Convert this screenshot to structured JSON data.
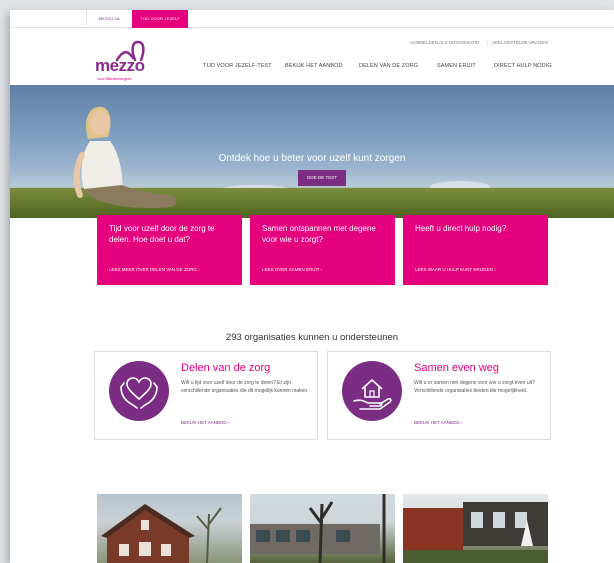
{
  "colors": {
    "brand_pink": "#e5007e",
    "brand_purple": "#7a2d82",
    "logo_purple": "#8a2c8b"
  },
  "top_tabs": [
    {
      "label": "Mezzo.nl",
      "active": false
    },
    {
      "label": "Tijd voor jezelf",
      "active": true
    }
  ],
  "logo": {
    "word": "mezzo",
    "sub": "voor Mantelzorgers"
  },
  "utility_nav": [
    {
      "label": "Aanmelden als organisatie"
    },
    {
      "label": "|"
    },
    {
      "label": "Veelgestelde vragen"
    }
  ],
  "main_nav": [
    {
      "label": "Tijd voor jezelf-test"
    },
    {
      "label": "Bekijk het aanbod"
    },
    {
      "label": "Delen van de zorg"
    },
    {
      "label": "Samen eruit"
    },
    {
      "label": "Direct hulp nodig"
    }
  ],
  "hero": {
    "title": "Ontdek hoe u beter voor uzelf kunt zorgen",
    "button": "Doe de test"
  },
  "promos": [
    {
      "title": "Tijd voor uzelf door de zorg te delen. Hoe doet u dat?",
      "link": "Lees meer over delen van de zorg  ›"
    },
    {
      "title": "Samen ontspannen met degene voor wie u zorgt?",
      "link": "Lees over samen eruit  ›"
    },
    {
      "title": "Heeft u direct hulp nodig?",
      "link": "Lees waar u hulp kunt krijgen  ›"
    }
  ],
  "organizations": {
    "title": "293 organisaties kunnen u ondersteunen"
  },
  "cards": [
    {
      "title": "Delen van de zorg",
      "icon": "caring-hands-heart-icon",
      "text": "Wilt u tijd voor uzelf door de zorg te delen? Er zijn verschillende organisaties die dit mogelijk kunnen maken.",
      "link": "Bekijk het aanbod  ›"
    },
    {
      "title": "Samen even weg",
      "icon": "hand-holding-house-icon",
      "text": "Wilt u er samen met degene voor wie u zorgt even uit? Verschillende organisaties bieden die mogelijkheid.",
      "link": "Bekijk het aanbod  ›"
    }
  ]
}
